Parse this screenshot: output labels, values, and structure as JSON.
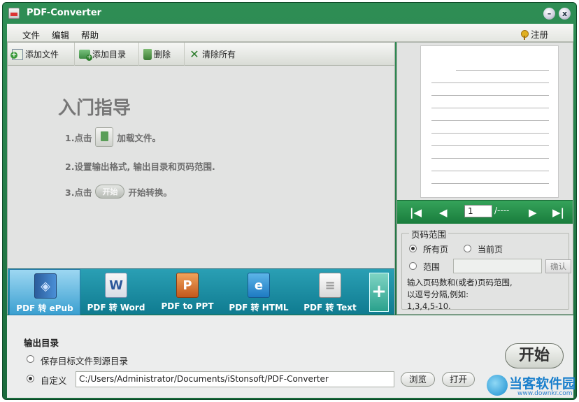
{
  "window": {
    "title": "PDF-Converter",
    "minimize": "–",
    "close": "x"
  },
  "menu": {
    "items": [
      "文件",
      "编辑",
      "帮助"
    ],
    "register": "注册"
  },
  "toolbar": {
    "add_file": "添加文件",
    "add_dir": "添加目录",
    "delete": "删除",
    "clear_all": "清除所有"
  },
  "guide": {
    "title": "入门指导",
    "step1_pre": "1.点击",
    "step1_post": "加载文件。",
    "step2": "2.设置输出格式, 输出目录和页码范围.",
    "step3_pre": "3.点击",
    "step3_btn": "开始",
    "step3_post": "开始转换。"
  },
  "formats": [
    {
      "label": "PDF 转 ePub",
      "icon": "epub-icon",
      "active": true
    },
    {
      "label": "PDF 转 Word",
      "icon": "word-icon"
    },
    {
      "label": "PDF to PPT",
      "icon": "ppt-icon"
    },
    {
      "label": "PDF 转 HTML",
      "icon": "html-icon"
    },
    {
      "label": "PDF 转 Text",
      "icon": "text-icon"
    }
  ],
  "formats_add": "+",
  "preview": {
    "page": "1",
    "total": "/----"
  },
  "range": {
    "title": "页码范围",
    "all": "所有页",
    "current": "当前页",
    "custom": "范围",
    "confirm": "确认",
    "hint": "输入页码数和(或者)页码范围,\n以逗号分隔,例如:\n1,3,4,5-10.",
    "selected": "all"
  },
  "output": {
    "title": "输出目录",
    "opt_source": "保存目标文件到源目录",
    "opt_custom": "自定义",
    "path": "C:/Users/Administrator/Documents/iStonsoft/PDF-Converter",
    "browse": "浏览",
    "open": "打开",
    "selected": "custom"
  },
  "start_button": "开始",
  "watermark": {
    "name": "当客软件园",
    "url": "www.downkr.com"
  }
}
